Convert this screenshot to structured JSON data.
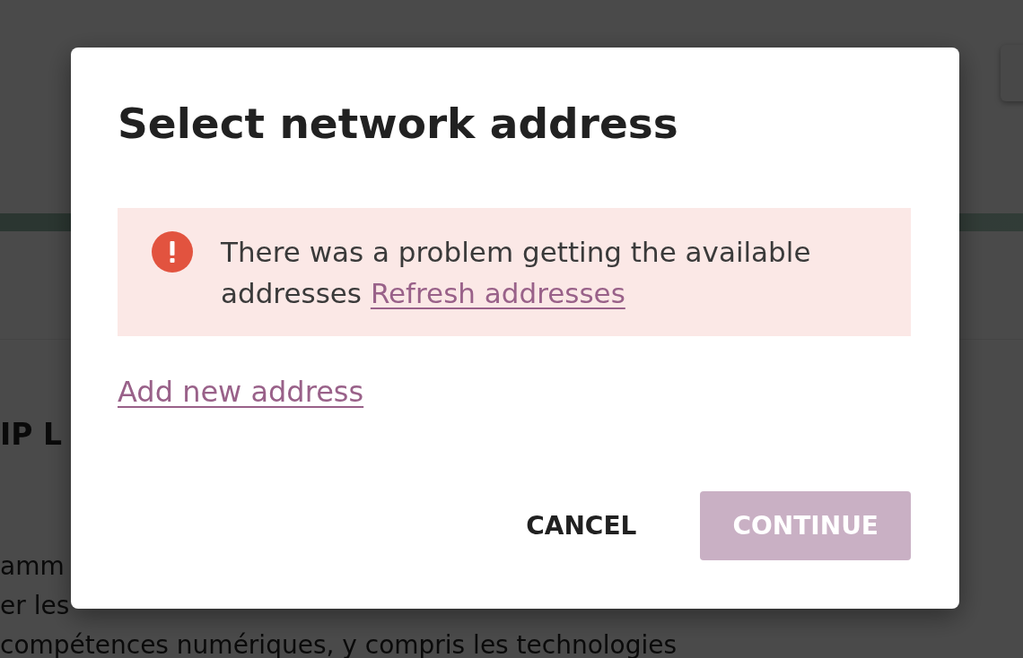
{
  "background_page": {
    "heading": "IP L",
    "paragraph_lines": [
      "amm",
      "er les",
      "compétences numériques, y compris les technologies"
    ]
  },
  "dialog": {
    "title": "Select network address",
    "alert": {
      "kind": "error",
      "message": "There was a problem getting the available addresses",
      "link": "Refresh addresses"
    },
    "add_link": "Add new address",
    "buttons": [
      {
        "label": "CANCEL",
        "kind": "text",
        "disabled": false
      },
      {
        "label": "CONTINUE",
        "kind": "primary",
        "disabled": true
      }
    ]
  }
}
